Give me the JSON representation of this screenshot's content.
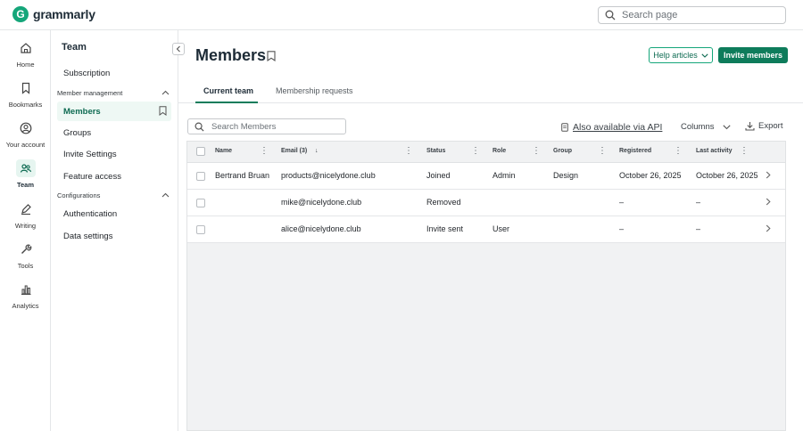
{
  "brand": {
    "name": "grammarly",
    "mark": "G"
  },
  "search": {
    "placeholder": "Search page"
  },
  "rail": [
    {
      "label": "Home",
      "icon": "home-icon"
    },
    {
      "label": "Bookmarks",
      "icon": "bookmark-icon"
    },
    {
      "label": "Your account",
      "icon": "account-icon"
    },
    {
      "label": "Team",
      "icon": "team-icon",
      "active": true
    },
    {
      "label": "Writing",
      "icon": "pen-icon"
    },
    {
      "label": "Tools",
      "icon": "tools-icon"
    },
    {
      "label": "Analytics",
      "icon": "analytics-icon"
    }
  ],
  "sidebar": {
    "title": "Team",
    "subscription": "Subscription",
    "group_members": "Member management",
    "members": "Members",
    "groups": "Groups",
    "invite_settings": "Invite Settings",
    "feature_access": "Feature access",
    "group_config": "Configurations",
    "authentication": "Authentication",
    "data_settings": "Data settings"
  },
  "page": {
    "title": "Members",
    "help": "Help articles",
    "invite": "Invite members"
  },
  "tabs": {
    "current": "Current team",
    "requests": "Membership requests"
  },
  "toolbar": {
    "search_placeholder": "Search Members",
    "api": "Also available via API",
    "columns": "Columns",
    "export": "Export"
  },
  "table": {
    "headers": {
      "name": "Name",
      "email": "Email (3)",
      "status": "Status",
      "role": "Role",
      "group": "Group",
      "registered": "Registered",
      "last_activity": "Last activity"
    },
    "rows": [
      {
        "name": "Bertrand Bruan",
        "email": "products@nicelydone.club",
        "status": "Joined",
        "role": "Admin",
        "group": "Design",
        "registered": "October 26, 2025",
        "last_activity": "October 26, 2025"
      },
      {
        "name": "",
        "email": "mike@nicelydone.club",
        "status": "Removed",
        "role": "",
        "group": "",
        "registered": "–",
        "last_activity": "–"
      },
      {
        "name": "",
        "email": "alice@nicelydone.club",
        "status": "Invite sent",
        "role": "User",
        "group": "",
        "registered": "–",
        "last_activity": "–"
      }
    ]
  },
  "colors": {
    "accent": "#0e7c5b",
    "brand": "#15a67a"
  }
}
